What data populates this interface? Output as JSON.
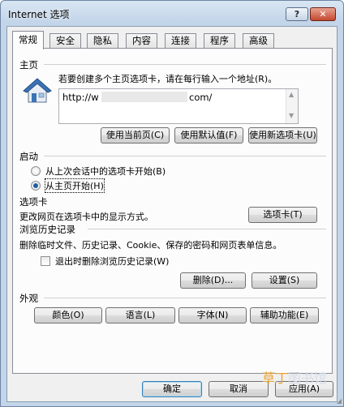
{
  "window": {
    "title": "Internet 选项",
    "help_label": "?",
    "close_label": "✕"
  },
  "tabs": [
    {
      "label": "常规",
      "active": true
    },
    {
      "label": "安全"
    },
    {
      "label": "隐私"
    },
    {
      "label": "内容"
    },
    {
      "label": "连接"
    },
    {
      "label": "程序"
    },
    {
      "label": "高级"
    }
  ],
  "home": {
    "title": "主页",
    "icon": "home-page-icon",
    "description": "若要创建多个主页选项卡，请在每行输入一个地址(R)。",
    "url_start": "http://w",
    "url_end": "com/",
    "buttons": {
      "use_current": "使用当前页(C)",
      "use_default": "使用默认值(F)",
      "use_new_tab": "使用新选项卡(U)"
    }
  },
  "startup": {
    "title": "启动",
    "option_last_session": "从上次会话中的选项卡开始(B)",
    "option_home": "从主页开始(H)",
    "selected": "home"
  },
  "tabs_section": {
    "title": "选项卡",
    "description": "更改网页在选项卡中的显示方式。",
    "button": "选项卡(T)"
  },
  "history": {
    "title": "浏览历史记录",
    "description": "删除临时文件、历史记录、Cookie、保存的密码和网页表单信息。",
    "checkbox_label": "退出时删除浏览历史记录(W)",
    "checkbox_checked": false,
    "delete_button": "删除(D)...",
    "settings_button": "设置(S)"
  },
  "appearance": {
    "title": "外观",
    "colors": "颜色(O)",
    "languages": "语言(L)",
    "fonts": "字体(N)",
    "accessibility": "辅助功能(E)"
  },
  "footer": {
    "ok": "确定",
    "cancel": "取消",
    "apply": "应用(A)"
  },
  "watermark": {
    "prefix": "草丁",
    "suffix": "图书馆"
  },
  "colors": {
    "title_bar": "#c3d5e9",
    "close": "#c44a2e",
    "radio_dot": "#1d5fa3"
  }
}
